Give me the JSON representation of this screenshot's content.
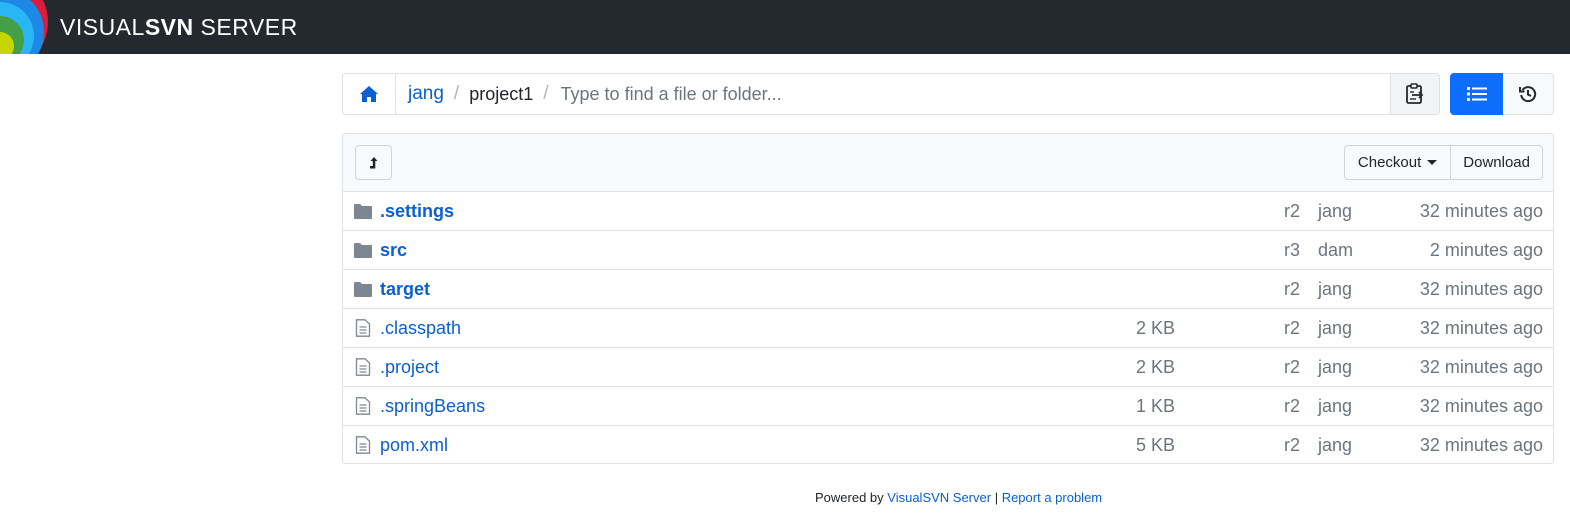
{
  "header": {
    "brand_thin_1": "VISUAL",
    "brand_bold": "SVN",
    "brand_thin_2": " SERVER"
  },
  "pathbar": {
    "crumbs": [
      {
        "label": "jang",
        "link": true
      },
      {
        "label": "project1",
        "link": false
      }
    ],
    "separator": "/",
    "find_placeholder": "Type to find a file or folder..."
  },
  "toolbar": {
    "checkout_label": "Checkout",
    "download_label": "Download"
  },
  "entries": [
    {
      "name": ".settings",
      "type": "folder",
      "size": "",
      "revision": "r2",
      "author": "jang",
      "modified": "32 minutes ago"
    },
    {
      "name": "src",
      "type": "folder",
      "size": "",
      "revision": "r3",
      "author": "dam",
      "modified": "2 minutes ago"
    },
    {
      "name": "target",
      "type": "folder",
      "size": "",
      "revision": "r2",
      "author": "jang",
      "modified": "32 minutes ago"
    },
    {
      "name": ".classpath",
      "type": "file",
      "size": "2 KB",
      "revision": "r2",
      "author": "jang",
      "modified": "32 minutes ago"
    },
    {
      "name": ".project",
      "type": "file",
      "size": "2 KB",
      "revision": "r2",
      "author": "jang",
      "modified": "32 minutes ago"
    },
    {
      "name": ".springBeans",
      "type": "file",
      "size": "1 KB",
      "revision": "r2",
      "author": "jang",
      "modified": "32 minutes ago"
    },
    {
      "name": "pom.xml",
      "type": "file",
      "size": "5 KB",
      "revision": "r2",
      "author": "jang",
      "modified": "32 minutes ago"
    }
  ],
  "footer": {
    "powered_by": "Powered by ",
    "product_link": "VisualSVN Server",
    "separator": " | ",
    "report_link": "Report a problem"
  },
  "colors": {
    "header_bg": "#24292f",
    "link": "#0a5fd1",
    "accent": "#0d6efd",
    "folder_icon": "#7d8791"
  }
}
